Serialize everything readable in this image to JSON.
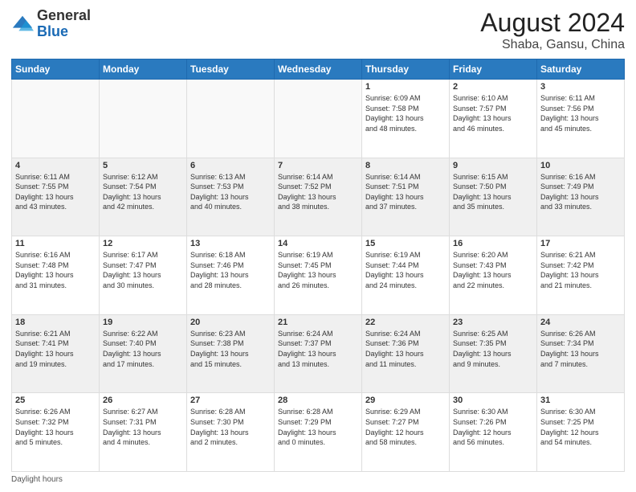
{
  "header": {
    "logo_general": "General",
    "logo_blue": "Blue",
    "month_year": "August 2024",
    "location": "Shaba, Gansu, China"
  },
  "days_of_week": [
    "Sunday",
    "Monday",
    "Tuesday",
    "Wednesday",
    "Thursday",
    "Friday",
    "Saturday"
  ],
  "weeks": [
    [
      {
        "day": "",
        "info": ""
      },
      {
        "day": "",
        "info": ""
      },
      {
        "day": "",
        "info": ""
      },
      {
        "day": "",
        "info": ""
      },
      {
        "day": "1",
        "info": "Sunrise: 6:09 AM\nSunset: 7:58 PM\nDaylight: 13 hours\nand 48 minutes."
      },
      {
        "day": "2",
        "info": "Sunrise: 6:10 AM\nSunset: 7:57 PM\nDaylight: 13 hours\nand 46 minutes."
      },
      {
        "day": "3",
        "info": "Sunrise: 6:11 AM\nSunset: 7:56 PM\nDaylight: 13 hours\nand 45 minutes."
      }
    ],
    [
      {
        "day": "4",
        "info": "Sunrise: 6:11 AM\nSunset: 7:55 PM\nDaylight: 13 hours\nand 43 minutes."
      },
      {
        "day": "5",
        "info": "Sunrise: 6:12 AM\nSunset: 7:54 PM\nDaylight: 13 hours\nand 42 minutes."
      },
      {
        "day": "6",
        "info": "Sunrise: 6:13 AM\nSunset: 7:53 PM\nDaylight: 13 hours\nand 40 minutes."
      },
      {
        "day": "7",
        "info": "Sunrise: 6:14 AM\nSunset: 7:52 PM\nDaylight: 13 hours\nand 38 minutes."
      },
      {
        "day": "8",
        "info": "Sunrise: 6:14 AM\nSunset: 7:51 PM\nDaylight: 13 hours\nand 37 minutes."
      },
      {
        "day": "9",
        "info": "Sunrise: 6:15 AM\nSunset: 7:50 PM\nDaylight: 13 hours\nand 35 minutes."
      },
      {
        "day": "10",
        "info": "Sunrise: 6:16 AM\nSunset: 7:49 PM\nDaylight: 13 hours\nand 33 minutes."
      }
    ],
    [
      {
        "day": "11",
        "info": "Sunrise: 6:16 AM\nSunset: 7:48 PM\nDaylight: 13 hours\nand 31 minutes."
      },
      {
        "day": "12",
        "info": "Sunrise: 6:17 AM\nSunset: 7:47 PM\nDaylight: 13 hours\nand 30 minutes."
      },
      {
        "day": "13",
        "info": "Sunrise: 6:18 AM\nSunset: 7:46 PM\nDaylight: 13 hours\nand 28 minutes."
      },
      {
        "day": "14",
        "info": "Sunrise: 6:19 AM\nSunset: 7:45 PM\nDaylight: 13 hours\nand 26 minutes."
      },
      {
        "day": "15",
        "info": "Sunrise: 6:19 AM\nSunset: 7:44 PM\nDaylight: 13 hours\nand 24 minutes."
      },
      {
        "day": "16",
        "info": "Sunrise: 6:20 AM\nSunset: 7:43 PM\nDaylight: 13 hours\nand 22 minutes."
      },
      {
        "day": "17",
        "info": "Sunrise: 6:21 AM\nSunset: 7:42 PM\nDaylight: 13 hours\nand 21 minutes."
      }
    ],
    [
      {
        "day": "18",
        "info": "Sunrise: 6:21 AM\nSunset: 7:41 PM\nDaylight: 13 hours\nand 19 minutes."
      },
      {
        "day": "19",
        "info": "Sunrise: 6:22 AM\nSunset: 7:40 PM\nDaylight: 13 hours\nand 17 minutes."
      },
      {
        "day": "20",
        "info": "Sunrise: 6:23 AM\nSunset: 7:38 PM\nDaylight: 13 hours\nand 15 minutes."
      },
      {
        "day": "21",
        "info": "Sunrise: 6:24 AM\nSunset: 7:37 PM\nDaylight: 13 hours\nand 13 minutes."
      },
      {
        "day": "22",
        "info": "Sunrise: 6:24 AM\nSunset: 7:36 PM\nDaylight: 13 hours\nand 11 minutes."
      },
      {
        "day": "23",
        "info": "Sunrise: 6:25 AM\nSunset: 7:35 PM\nDaylight: 13 hours\nand 9 minutes."
      },
      {
        "day": "24",
        "info": "Sunrise: 6:26 AM\nSunset: 7:34 PM\nDaylight: 13 hours\nand 7 minutes."
      }
    ],
    [
      {
        "day": "25",
        "info": "Sunrise: 6:26 AM\nSunset: 7:32 PM\nDaylight: 13 hours\nand 5 minutes."
      },
      {
        "day": "26",
        "info": "Sunrise: 6:27 AM\nSunset: 7:31 PM\nDaylight: 13 hours\nand 4 minutes."
      },
      {
        "day": "27",
        "info": "Sunrise: 6:28 AM\nSunset: 7:30 PM\nDaylight: 13 hours\nand 2 minutes."
      },
      {
        "day": "28",
        "info": "Sunrise: 6:28 AM\nSunset: 7:29 PM\nDaylight: 13 hours\nand 0 minutes."
      },
      {
        "day": "29",
        "info": "Sunrise: 6:29 AM\nSunset: 7:27 PM\nDaylight: 12 hours\nand 58 minutes."
      },
      {
        "day": "30",
        "info": "Sunrise: 6:30 AM\nSunset: 7:26 PM\nDaylight: 12 hours\nand 56 minutes."
      },
      {
        "day": "31",
        "info": "Sunrise: 6:30 AM\nSunset: 7:25 PM\nDaylight: 12 hours\nand 54 minutes."
      }
    ]
  ],
  "footer": {
    "note": "Daylight hours"
  },
  "colors": {
    "header_bg": "#2a7abf",
    "header_text": "#ffffff",
    "brand_blue": "#1a6ab5"
  }
}
